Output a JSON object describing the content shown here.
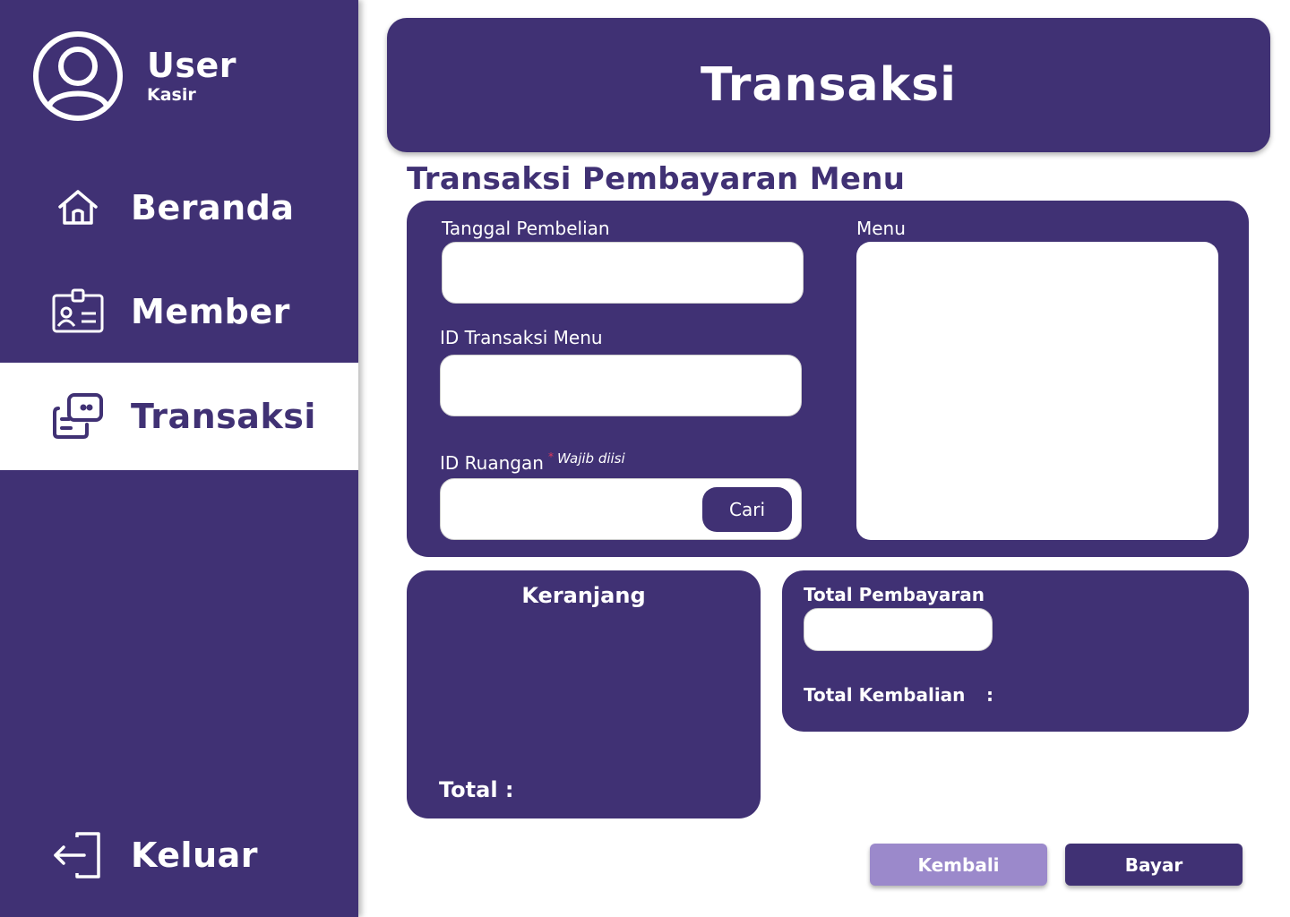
{
  "colors": {
    "primary": "#403174",
    "secondary": "#9b89cb",
    "background": "#ffffff",
    "required": "#e23a5b"
  },
  "profile": {
    "name": "User",
    "role": "Kasir",
    "icon": "user-avatar-icon"
  },
  "nav": {
    "beranda": {
      "label": "Beranda",
      "icon": "home-icon"
    },
    "member": {
      "label": "Member",
      "icon": "id-card-icon"
    },
    "transaksi": {
      "label": "Transaksi",
      "icon": "transaction-icon",
      "active": true
    },
    "keluar": {
      "label": "Keluar",
      "icon": "logout-icon"
    }
  },
  "header": {
    "title": "Transaksi"
  },
  "section": {
    "title": "Transaksi Pembayaran Menu"
  },
  "form": {
    "tanggal_label": "Tanggal Pembelian",
    "tanggal_value": "",
    "id_transaksi_label": "ID Transaksi Menu",
    "id_transaksi_value": "",
    "id_ruangan_label": "ID Ruangan",
    "id_ruangan_value": "",
    "required_note": "Wajib diisi",
    "required_star": "*",
    "cari_label": "Cari",
    "menu_label": "Menu"
  },
  "cart": {
    "title": "Keranjang",
    "total_label": "Total :"
  },
  "payment": {
    "total_pembayaran_label": "Total Pembayaran",
    "total_pembayaran_value": "",
    "total_kembalian_label": "Total Kembalian",
    "kembalian_separator": ":"
  },
  "actions": {
    "kembali": "Kembali",
    "bayar": "Bayar"
  }
}
